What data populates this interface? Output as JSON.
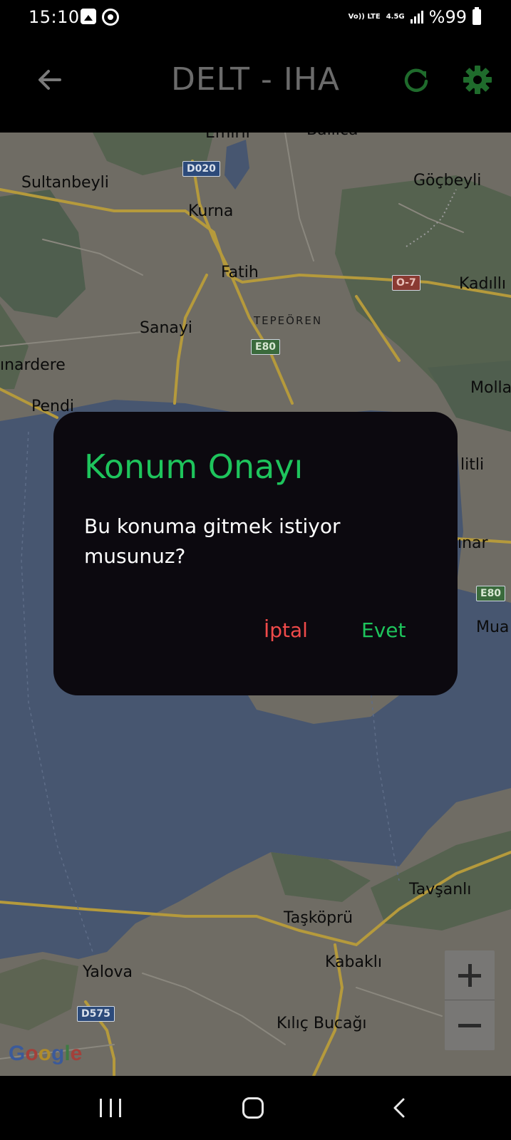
{
  "status_bar": {
    "time": "15:10",
    "network_volte": "Vo)) LTE",
    "network_type": "4.5G",
    "battery": "%99",
    "icons": [
      "gallery-icon",
      "whatsapp-icon",
      "signal-icon",
      "battery-icon"
    ]
  },
  "app_bar": {
    "title": "DELT - IHA",
    "back_icon": "arrow-left-icon",
    "refresh_icon": "refresh-icon",
    "settings_icon": "gear-icon",
    "accent_color": "#1f6b2c"
  },
  "map": {
    "labels": {
      "emirli": "Emirli",
      "ballica": "Ballıca",
      "sultanbeyli": "Sultanbeyli",
      "kurna": "Kurna",
      "gocbeyli": "Göçbeyli",
      "fatih": "Fatih",
      "kadilli": "Kadıllı",
      "tepeoren": "TEPEÖREN",
      "sanayi": "Sanayi",
      "pinardere": "ınardere",
      "pendik": "Pendi",
      "molla": "Molla",
      "ciftlik": "litli",
      "pinar": "ınar",
      "mua": "Mua",
      "tavsanli": "Tavşanlı",
      "taskopru": "Taşköprü",
      "kabakli": "Kabaklı",
      "yalova": "Yalova",
      "kilic_bucagi": "Kılıç Bucağı"
    },
    "shields": {
      "d020": "D020",
      "o7": "O-7",
      "e80_a": "E80",
      "e80_b": "E80",
      "d575": "D575"
    },
    "google_logo": "Google",
    "zoom_in_icon": "plus-icon",
    "zoom_out_icon": "minus-icon"
  },
  "dialog": {
    "title": "Konum Onayı",
    "message": "Bu konuma gitmek istiyor musunuz?",
    "cancel_label": "İptal",
    "confirm_label": "Evet",
    "title_color": "#1ec45c",
    "cancel_color": "#f04a4a"
  },
  "nav_bar": {
    "icons": [
      "recent-apps-icon",
      "home-icon",
      "back-icon"
    ]
  }
}
